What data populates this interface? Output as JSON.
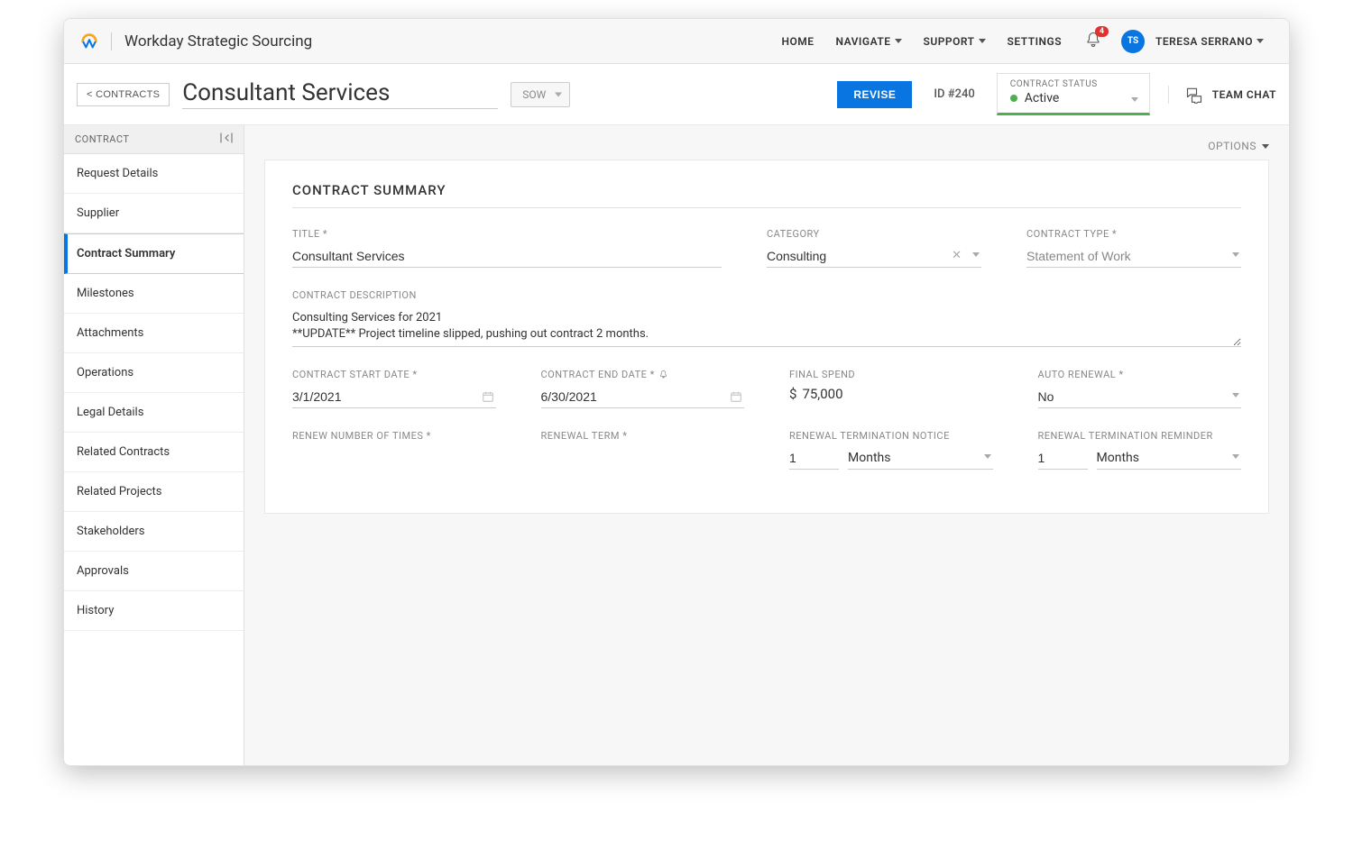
{
  "brand": "Workday Strategic Sourcing",
  "topnav": {
    "home": "HOME",
    "navigate": "NAVIGATE",
    "support": "SUPPORT",
    "settings": "SETTINGS",
    "notification_count": "4",
    "user_initials": "TS",
    "user_name": "TERESA SERRANO"
  },
  "subheader": {
    "back": "< CONTRACTS",
    "title": "Consultant Services",
    "type_short": "SOW",
    "revise": "REVISE",
    "id_label": "ID #240",
    "status_label": "CONTRACT STATUS",
    "status_value": "Active",
    "team_chat": "TEAM CHAT"
  },
  "sidebar": {
    "header": "CONTRACT",
    "items": [
      "Request Details",
      "Supplier",
      "Contract Summary",
      "Milestones",
      "Attachments",
      "Operations",
      "Legal Details",
      "Related Contracts",
      "Related Projects",
      "Stakeholders",
      "Approvals",
      "History"
    ],
    "active_index": 2
  },
  "main": {
    "options": "OPTIONS",
    "card_title": "CONTRACT SUMMARY",
    "labels": {
      "title": "TITLE *",
      "category": "CATEGORY",
      "contract_type": "CONTRACT TYPE *",
      "description": "CONTRACT DESCRIPTION",
      "start_date": "CONTRACT START DATE *",
      "end_date": "CONTRACT END DATE *",
      "final_spend": "FINAL SPEND",
      "auto_renewal": "AUTO RENEWAL *",
      "renew_times": "RENEW NUMBER OF TIMES *",
      "renewal_term": "RENEWAL TERM *",
      "termination_notice": "RENEWAL TERMINATION NOTICE",
      "termination_reminder": "RENEWAL TERMINATION REMINDER"
    },
    "values": {
      "title": "Consultant Services",
      "category": "Consulting",
      "contract_type": "Statement of Work",
      "description": "Consulting Services for 2021\n**UPDATE** Project timeline slipped, pushing out contract 2 months.",
      "start_date": "3/1/2021",
      "end_date": "6/30/2021",
      "final_spend_currency": "$",
      "final_spend_amount": "75,000",
      "auto_renewal": "No",
      "termination_notice_value": "1",
      "termination_notice_unit": "Months",
      "termination_reminder_value": "1",
      "termination_reminder_unit": "Months"
    }
  }
}
